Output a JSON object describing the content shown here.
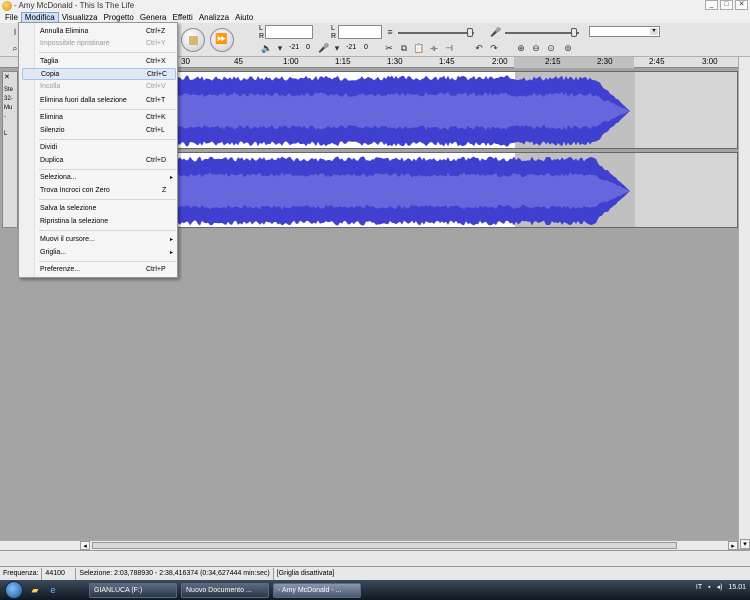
{
  "window": {
    "title": "- Amy McDonald - This Is The Life"
  },
  "menubar": {
    "items": [
      "File",
      "Modifica",
      "Visualizza",
      "Progetto",
      "Genera",
      "Effetti",
      "Analizza",
      "Aiuto"
    ]
  },
  "toolbar": {
    "meter_play_l": "L",
    "meter_play_r": "R",
    "meter_rec_l": "L",
    "meter_rec_r": "R",
    "meter_db1": "-21",
    "meter_zero1": "0",
    "meter_db2": "-21",
    "meter_zero2": "0",
    "rate_dropdown_value": ""
  },
  "ruler": {
    "ticks": [
      "30",
      "45",
      "1:00",
      "1:15",
      "1:30",
      "1:45",
      "2:00",
      "2:15",
      "2:30",
      "2:45",
      "3:00"
    ]
  },
  "tracks": [
    {
      "info_lines": [
        "Ste",
        "32-",
        "Mu",
        "-",
        "L"
      ]
    }
  ],
  "edit_menu": {
    "items": [
      {
        "label": "Annulla Elimina",
        "shortcut": "Ctrl+Z",
        "enabled": true
      },
      {
        "label": "Impossibile ripristinare",
        "shortcut": "Ctrl+Y",
        "enabled": false
      },
      {
        "label": "Taglia",
        "shortcut": "Ctrl+X",
        "enabled": true
      },
      {
        "label": "Copia",
        "shortcut": "Ctrl+C",
        "enabled": true,
        "highlighted": true
      },
      {
        "label": "Incolla",
        "shortcut": "Ctrl+V",
        "enabled": false
      },
      {
        "label": "Elimina fuori dalla selezione",
        "shortcut": "Ctrl+T",
        "enabled": true
      },
      {
        "label": "Elimina",
        "shortcut": "Ctrl+K",
        "enabled": true
      },
      {
        "label": "Silenzio",
        "shortcut": "Ctrl+L",
        "enabled": true
      },
      {
        "label": "Dividi",
        "shortcut": "",
        "enabled": true
      },
      {
        "label": "Duplica",
        "shortcut": "Ctrl+D",
        "enabled": true
      },
      {
        "label": "Seleziona...",
        "shortcut": "",
        "enabled": true,
        "submenu": true
      },
      {
        "label": "Trova Incroci con Zero",
        "shortcut": "Z",
        "enabled": true
      },
      {
        "label": "Salva la selezione",
        "shortcut": "",
        "enabled": true
      },
      {
        "label": "Ripristina la selezione",
        "shortcut": "",
        "enabled": true
      },
      {
        "label": "Muovi il cursore...",
        "shortcut": "",
        "enabled": true,
        "submenu": true
      },
      {
        "label": "Griglia...",
        "shortcut": "",
        "enabled": true,
        "submenu": true
      },
      {
        "label": "Preferenze...",
        "shortcut": "Ctrl+P",
        "enabled": true
      }
    ]
  },
  "statusbar": {
    "freq_label": "Frequenza:",
    "freq_value": "44100",
    "selection": "Selezione: 2:03,788930 - 2:38,416374 (0:34,627444 min:sec)",
    "grid": "[Griglia disattivata]"
  },
  "taskbar": {
    "tasks": [
      "GIANLUCA (F:)",
      "Nuovo Documento ...",
      "- Amy McDonald - ..."
    ],
    "lang": "IT",
    "clock": "15.01"
  },
  "colors": {
    "waveform": "#3f3fd0",
    "waveform_light": "#6666dd",
    "selection": "#c0c0c0"
  }
}
